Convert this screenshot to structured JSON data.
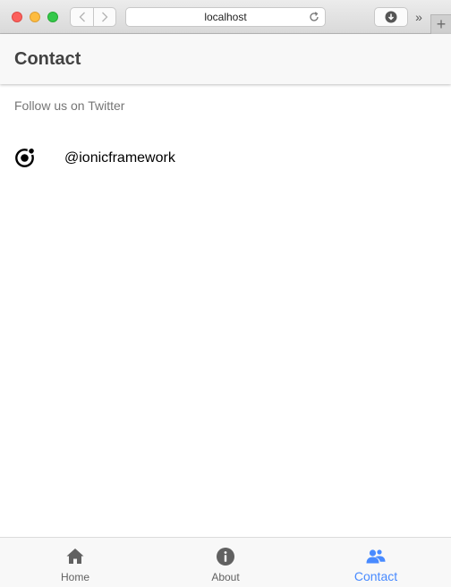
{
  "browser": {
    "url": "localhost",
    "more_glyph": "»",
    "newtab_glyph": "+"
  },
  "header": {
    "title": "Contact"
  },
  "content": {
    "list_header": "Follow us on Twitter",
    "items": [
      {
        "label": "@ionicframework",
        "icon": "ionic-logo-icon"
      }
    ]
  },
  "tabs": [
    {
      "label": "Home",
      "icon": "home-icon",
      "active": false
    },
    {
      "label": "About",
      "icon": "info-icon",
      "active": false
    },
    {
      "label": "Contact",
      "icon": "contacts-icon",
      "active": true
    }
  ],
  "colors": {
    "accent": "#488aff",
    "header_bg": "#f8f8f8",
    "text_dark": "#424242",
    "text_muted": "#757575"
  }
}
